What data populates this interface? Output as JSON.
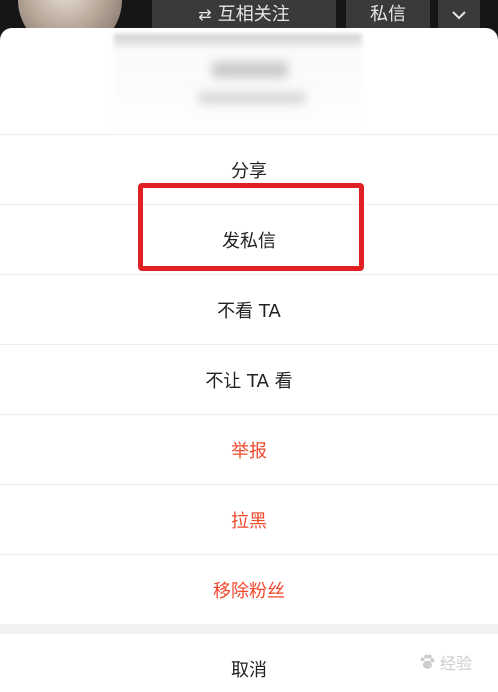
{
  "profile_bar": {
    "follow_label": "互相关注",
    "follow_icon": "swap-arrows-icon",
    "message_label": "私信",
    "more_icon": "chevron-down-icon"
  },
  "sheet": {
    "options": [
      {
        "label": "分享",
        "color": "#222222"
      },
      {
        "label": "发私信",
        "color": "#222222"
      },
      {
        "label": "不看 TA",
        "color": "#222222"
      },
      {
        "label": "不让 TA 看",
        "color": "#222222"
      },
      {
        "label": "举报",
        "color": "#f2482c"
      },
      {
        "label": "拉黑",
        "color": "#f2482c"
      },
      {
        "label": "移除粉丝",
        "color": "#f2482c"
      }
    ],
    "cancel_label": "取消"
  },
  "highlight": {
    "color": "#e12024",
    "target": "发私信"
  },
  "watermark": {
    "text": "经验"
  }
}
